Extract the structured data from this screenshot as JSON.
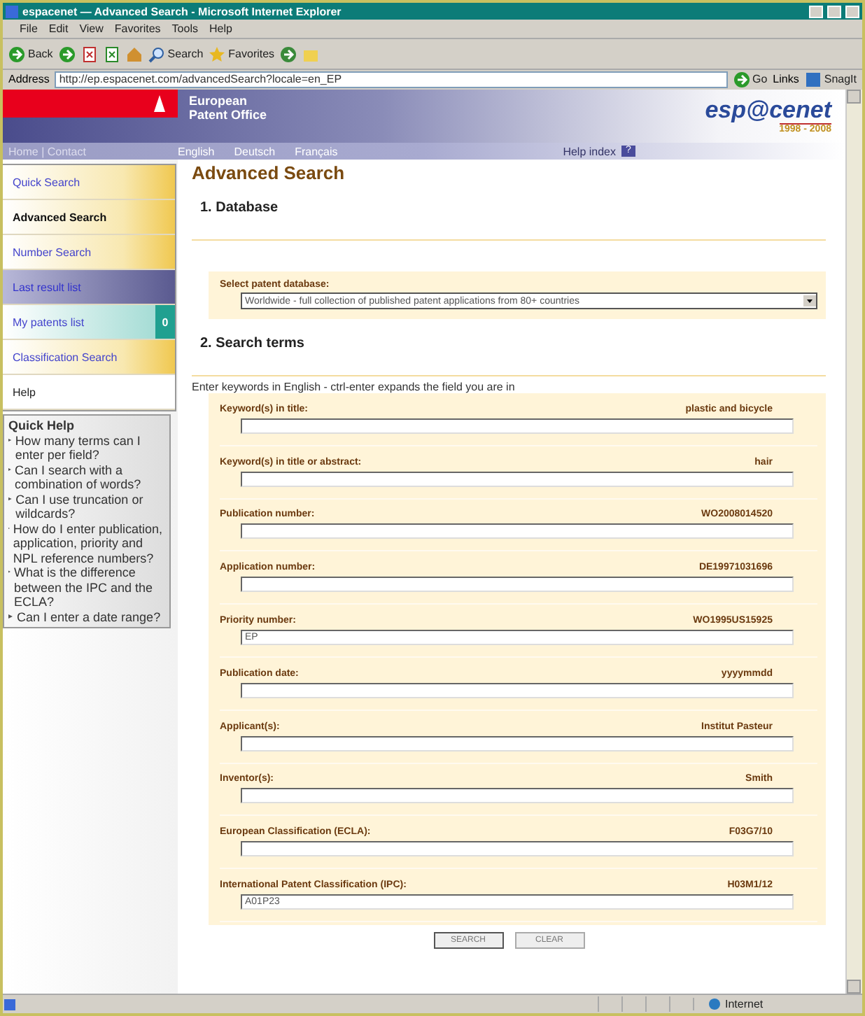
{
  "window": {
    "title": "espacenet — Advanced Search - Microsoft Internet Explorer"
  },
  "menu": [
    "File",
    "Edit",
    "View",
    "Favorites",
    "Tools",
    "Help"
  ],
  "toolbar": {
    "back": "Back",
    "search": "Search",
    "favorites": "Favorites"
  },
  "address": {
    "label": "Address",
    "value": "http://ep.espacenet.com/advancedSearch?locale=en_EP",
    "go": "Go",
    "links": "Links",
    "snagit": "SnagIt"
  },
  "header": {
    "office": [
      "European",
      "Patent Office"
    ],
    "logo": "esp@cenet",
    "years": "1998 - 2008",
    "top_links": "Home | Contact",
    "languages": [
      "English",
      "Deutsch",
      "Français"
    ],
    "help_index": "Help index",
    "help_icon": "?"
  },
  "nav": [
    {
      "label": "Quick Search",
      "kind": "gold",
      "selected": false
    },
    {
      "label": "Advanced Search",
      "kind": "gold",
      "selected": true
    },
    {
      "label": "Number Search",
      "kind": "gold",
      "selected": false
    },
    {
      "label": "Last result list",
      "kind": "dark",
      "selected": false
    },
    {
      "label": "My patents list",
      "kind": "teal",
      "selected": false,
      "badge": "0"
    },
    {
      "label": "Classification Search",
      "kind": "gold",
      "selected": false
    },
    {
      "label": "Help",
      "kind": "plain",
      "selected": false
    }
  ],
  "quick_help": {
    "title": "Quick Help",
    "items": [
      "How many terms can I enter per field?",
      "Can I search with a combination of words?",
      "Can I use truncation or wildcards?",
      "How do I enter publication, application, priority and NPL reference numbers?",
      "What is the difference between the IPC and the ECLA?",
      "Can I enter a date range?"
    ]
  },
  "page_title": "Advanced Search",
  "database": {
    "heading": "1. Database",
    "label": "Select patent database:",
    "value": "Worldwide - full collection of published patent applications from 80+ countries"
  },
  "search_terms": {
    "heading": "2. Search terms",
    "hint": "Enter keywords in English - ctrl-enter expands the field you are in",
    "fields": [
      {
        "label": "Keyword(s) in title:",
        "example": "plastic and bicycle"
      },
      {
        "label": "Keyword(s) in title or abstract:",
        "example": "hair"
      },
      {
        "label": "Publication number:",
        "example": "WO2008014520"
      },
      {
        "label": "Application number:",
        "example": "DE19971031696"
      },
      {
        "label": "Priority number:",
        "example": "WO1995US15925",
        "value": "EP"
      },
      {
        "label": "Publication date:",
        "example": "yyyymmdd"
      },
      {
        "label": "Applicant(s):",
        "example": "Institut Pasteur"
      },
      {
        "label": "Inventor(s):",
        "example": "Smith"
      },
      {
        "label": "European Classification (ECLA):",
        "example": "F03G7/10"
      },
      {
        "label": "International Patent Classification (IPC):",
        "example": "H03M1/12",
        "value": "A01P23"
      }
    ]
  },
  "buttons": [
    "SEARCH",
    "CLEAR"
  ],
  "status": {
    "zone": "Internet"
  }
}
